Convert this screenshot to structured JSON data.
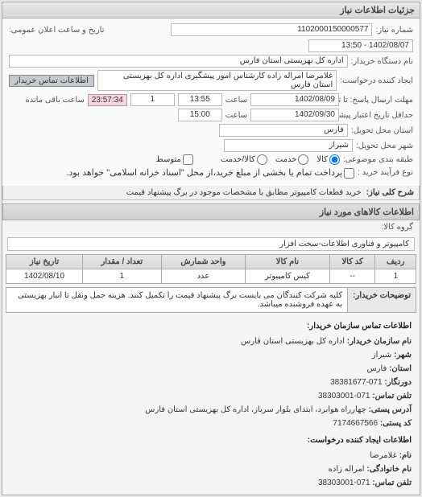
{
  "panel_title": "جزئیات اطلاعات نیاز",
  "form": {
    "niaz_no_label": "شماره نیاز:",
    "niaz_no": "1102000150000577",
    "announce_label": "تاریخ و ساعت اعلان عمومی:",
    "announce_val": "1402/08/07 - 13:50",
    "buyer_device_label": "نام دستگاه خریدار:",
    "buyer_device": "اداره کل بهزیستی استان فارس",
    "requester_label": "ایجاد کننده درخواست:",
    "requester": "غلامرضا امراله زاده کارشناس امور پیشگیری اداره کل بهزیستی استان فارس",
    "buyer_contact_btn": "اطلاعات تماس خریدار",
    "deadline_send_label": "مهلت ارسال پاسخ: تا تاریخ:",
    "deadline_date": "1402/08/09",
    "time_label": "ساعت",
    "deadline_time": "13:55",
    "days_remain": "1",
    "time_remain": "23:57:34",
    "days_remain_suffix": "ساعت باقی مانده",
    "validity_label": "حداقل تاریخ اعتبار پیشنهاد: تا تاریخ:",
    "validity_date": "1402/09/30",
    "validity_time": "15:00",
    "province_label": "استان محل تحویل:",
    "province": "فارس",
    "city_label": "شهر محل تحویل:",
    "city": "شیراز",
    "subject_class_label": "طبقه بندی موضوعی:",
    "radio_goods": "کالا",
    "radio_service": "خدمت",
    "radio_goods_service": "کالا/خدمت",
    "checkbox_avg": "متوسط",
    "buy_type_label": "نوع فرآیند خرید :",
    "buy_type_note": "پرداخت تمام یا بخشی از مبلغ خرید،از محل \"اسناد خزانه اسلامی\" خواهد بود.",
    "general_title_label": "شرح کلی نیاز:",
    "general_title": "خرید قطعات کامپیوتر مطابق با مشخصات موجود در برگ پیشنهاد قیمت"
  },
  "goods_section_title": "اطلاعات کالاهای مورد نیاز",
  "goods_group_label": "گروه کالا:",
  "goods_group": "کامپیوتر و فناوری اطلاعات-سخت افزار",
  "table": {
    "headers": [
      "ردیف",
      "کد کالا",
      "نام کالا",
      "واحد شمارش",
      "تعداد / مقدار",
      "تاریخ نیاز"
    ],
    "rows": [
      [
        "1",
        "--",
        "کیس کامپیوتر",
        "عدد",
        "1",
        "1402/08/10"
      ]
    ]
  },
  "buyer_desc_label": "توضیحات خریدار:",
  "buyer_desc": "کلیه شرکت کنندگان می بایست برگ پیشنهاد قیمت را تکمیل کنند. هزینه حمل ونقل تا انبار بهزیستی به عهده فروشنده میباشد.",
  "contact": {
    "title1": "اطلاعات تماس سازمان خریدار:",
    "org_label": "نام سازمان خریدار:",
    "org": "اداره کل بهزیستی استان فارس",
    "city_label": "شهر:",
    "city": "شیراز",
    "province_label": "استان:",
    "province": "فارس",
    "fax_label": "دورنگار:",
    "fax": "071-38381677",
    "phone_label": "تلفن تماس:",
    "phone": "071-38303001",
    "addr_label": "آدرس پستی:",
    "addr": "چهارراه هوابرد، ابتدای بلوار سرباز، اداره کل بهزیستی استان فارس",
    "postal_label": "کد پستی:",
    "postal": "7174667566",
    "title2": "اطلاعات ایجاد کننده درخواست:",
    "name_label": "نام:",
    "name": "غلامرضا",
    "family_label": "نام خانوادگی:",
    "family": "امراله زاده",
    "phone2_label": "تلفن تماس:",
    "phone2": "071-38303001"
  }
}
